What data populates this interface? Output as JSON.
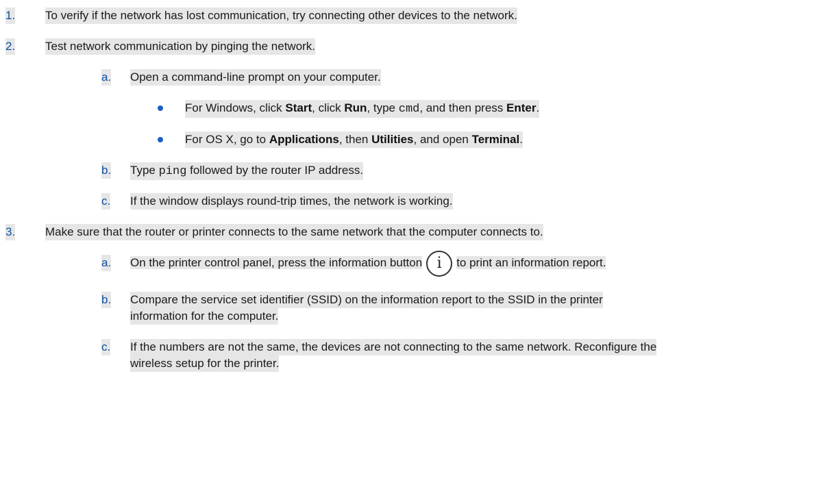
{
  "steps": [
    {
      "num": "1.",
      "text": "To verify if the network has lost communication, try connecting other devices to the network."
    },
    {
      "num": "2.",
      "text": "Test network communication by pinging the network.",
      "sub": [
        {
          "letter": "a.",
          "text": "Open a command-line prompt on your computer.",
          "bullets": [
            {
              "p1": "For Windows, click ",
              "b1": "Start",
              "p2": ", click ",
              "b2": "Run",
              "p3": ", type ",
              "code": "cmd",
              "p4": ", and then press ",
              "b3": "Enter",
              "p5": "."
            },
            {
              "p1": "For OS X, go to ",
              "b1": "Applications",
              "p2": ", then ",
              "b2": "Utilities",
              "p3": ", and open ",
              "b3": "Terminal",
              "p4": "."
            }
          ]
        },
        {
          "letter": "b.",
          "p1": "Type ",
          "code": "ping",
          "p2": " followed by the router IP address."
        },
        {
          "letter": "c.",
          "text": "If the window displays round-trip times, the network is working."
        }
      ]
    },
    {
      "num": "3.",
      "text": "Make sure that the router or printer connects to the same network that the computer connects to.",
      "sub": [
        {
          "letter": "a.",
          "p1": "On the printer control panel, press the information button",
          "icon": "i",
          "p2": "to print an information report."
        },
        {
          "letter": "b.",
          "line1": "Compare the service set identifier (SSID) on the information report to the SSID in the printer",
          "line2": "information for the computer."
        },
        {
          "letter": "c.",
          "line1": "If the numbers are not the same, the devices are not connecting to the same network. Reconfigure the",
          "line2": "wireless setup for the printer."
        }
      ]
    }
  ],
  "colors": {
    "number": "#0e4fa3",
    "bullet": "#1b60c3",
    "highlight": "#e6e6e6"
  },
  "icons": {
    "information_button": "info-circle-icon"
  }
}
